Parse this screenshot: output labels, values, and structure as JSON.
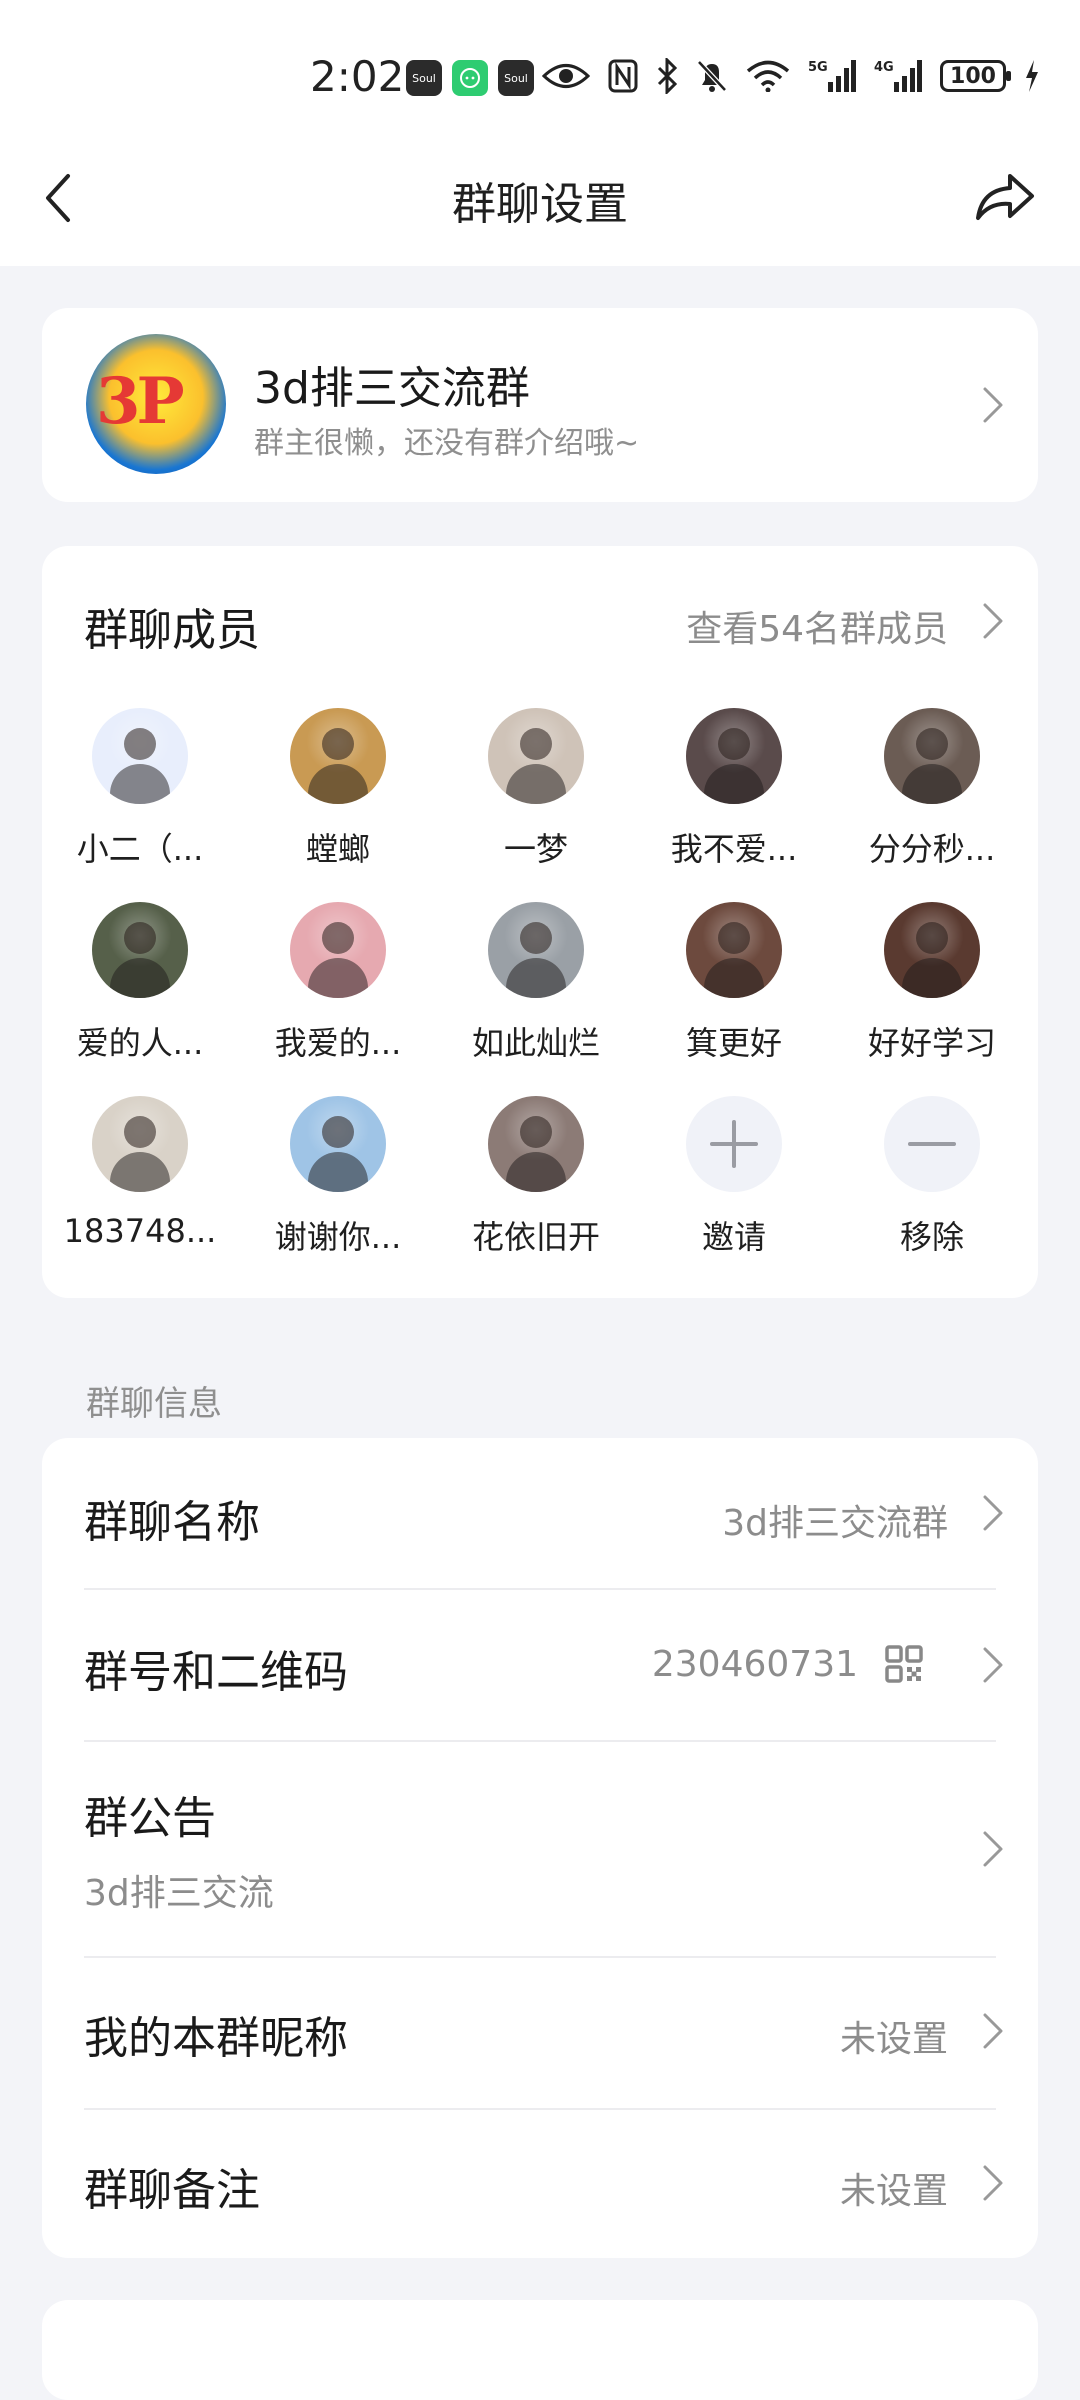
{
  "status": {
    "time": "2:02",
    "apps": [
      {
        "name": "soul-app-icon",
        "label": "Soul",
        "color": "#2b2b2b"
      },
      {
        "name": "wechat-app-icon",
        "label": "",
        "color": "#2ecc71"
      },
      {
        "name": "soul-app-icon-2",
        "label": "Soul",
        "color": "#2b2b2b"
      }
    ],
    "battery": "100",
    "signal_1": "5G",
    "signal_2": "4G"
  },
  "navbar": {
    "title": "群聊设置"
  },
  "group": {
    "name": "3d排三交流群",
    "description": "群主很懒，还没有群介绍哦~",
    "avatar_text": "3P"
  },
  "members": {
    "title": "群聊成员",
    "view_all": "查看54名群成员",
    "list": [
      {
        "name": "小二（...",
        "color": "#e8eefc"
      },
      {
        "name": "螳螂",
        "color": "#c99a53"
      },
      {
        "name": "一梦",
        "color": "#cfc3b8"
      },
      {
        "name": "我不爱...",
        "color": "#5a4b4b"
      },
      {
        "name": "分分秒...",
        "color": "#6b5c54"
      },
      {
        "name": "爱的人...",
        "color": "#56604a"
      },
      {
        "name": "我爱的...",
        "color": "#e6a9b0"
      },
      {
        "name": "如此灿烂",
        "color": "#9aa0a6"
      },
      {
        "name": "箕更好",
        "color": "#6d4a3e"
      },
      {
        "name": "好好学习",
        "color": "#5a3a30"
      },
      {
        "name": "183748...",
        "color": "#d9d2c8"
      },
      {
        "name": "谢谢你...",
        "color": "#9fc4e6"
      },
      {
        "name": "花依旧开",
        "color": "#8c7b76"
      }
    ],
    "invite_label": "邀请",
    "remove_label": "移除"
  },
  "info_section": {
    "label": "群聊信息",
    "group_name_label": "群聊名称",
    "group_name_value": "3d排三交流群",
    "group_id_label": "群号和二维码",
    "group_id_value": "230460731",
    "announcement_label": "群公告",
    "announcement_value": "3d排三交流",
    "nickname_label": "我的本群昵称",
    "nickname_value": "未设置",
    "remark_label": "群聊备注",
    "remark_value": "未设置"
  }
}
